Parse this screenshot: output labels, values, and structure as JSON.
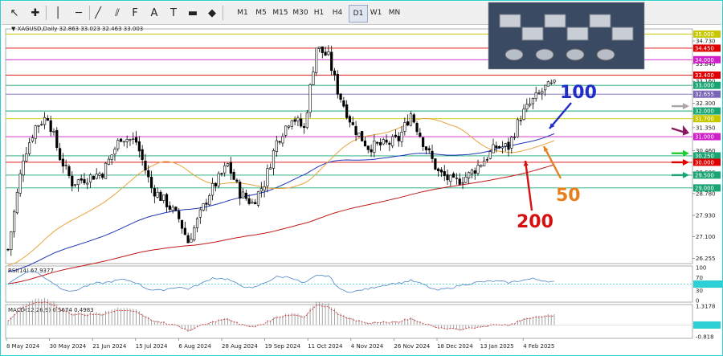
{
  "toolbar": {
    "tools": [
      {
        "icon": "cursor-arrow-icon"
      },
      {
        "icon": "crosshair-icon"
      },
      {
        "icon": "vertical-line-icon"
      },
      {
        "icon": "horizontal-line-icon"
      },
      {
        "icon": "trend-line-icon"
      },
      {
        "icon": "channel-icon"
      },
      {
        "icon": "fibonacci-icon"
      },
      {
        "icon": "text-icon"
      },
      {
        "icon": "text-label-icon"
      },
      {
        "icon": "rectangle-icon"
      },
      {
        "icon": "shapes-icon"
      }
    ],
    "timeframes": [
      "M1",
      "M5",
      "M15",
      "M30",
      "H1",
      "H4",
      "D1",
      "W1",
      "MN"
    ],
    "active_timeframe": "D1"
  },
  "colors": {
    "background": "#ffffff",
    "candle": "#000000",
    "ma50": "#e8a33d",
    "ma100": "#1f36b8",
    "ma200": "#c01818",
    "rsi": "#4a86c8",
    "macd": "#9a9a9a",
    "macd_signal": "#cc2a2a",
    "magenta_level": "#d01fc8",
    "green_level": "#1aa673",
    "red_level": "#e00000",
    "label_gray": "#aaa6a6",
    "label_blue": "#1f2ec8",
    "label_orange": "#e87f1e",
    "label_red": "#d60f0f"
  },
  "chart_data": {
    "type": "candlestick",
    "symbol": "XAGUSD,Daily",
    "ohlc": "32.863 33.023 32.463 33.003",
    "price_axis_ticks": [
      "34.730",
      "33.840",
      "33.160",
      "32.300",
      "31.350",
      "30.460",
      "29.600",
      "28.780",
      "27.930",
      "27.100",
      "26.255"
    ],
    "time_axis_labels": [
      "8 May 2024",
      "30 May 2024",
      "21 Jun 2024",
      "15 Jul 2024",
      "6 Aug 2024",
      "28 Aug 2024",
      "19 Sep 2024",
      "11 Oct 2024",
      "4 Nov 2024",
      "26 Nov 2024",
      "18 Dec 2024",
      "13 Jan 2025",
      "4 Feb 2025"
    ],
    "ylim": [
      26.05,
      35.2
    ],
    "levels": [
      {
        "value": 35.0,
        "label": "35.000",
        "color": "#c8c800"
      },
      {
        "value": 34.45,
        "label": "34.450",
        "color": "#e00000"
      },
      {
        "value": 34.0,
        "label": "34.000",
        "color": "#d01fc8"
      },
      {
        "value": 33.4,
        "label": "33.400",
        "color": "#e00000"
      },
      {
        "value": 33.0,
        "label": "33.000",
        "color": "#1aa673"
      },
      {
        "value": 32.655,
        "label": "32.655",
        "color": "#7a66b8"
      },
      {
        "value": 32.0,
        "label": "32.000",
        "color": "#1aa673"
      },
      {
        "value": 31.7,
        "label": "31.700",
        "color": "#c8c800"
      },
      {
        "value": 31.0,
        "label": "31.000",
        "color": "#d01fc8"
      },
      {
        "value": 30.25,
        "label": "30.250",
        "color": "#1aa673"
      },
      {
        "value": 30.0,
        "label": "30.000",
        "color": "#e00000"
      },
      {
        "value": 29.5,
        "label": "29.500",
        "color": "#1aa673"
      },
      {
        "value": 29.0,
        "label": "29.000",
        "color": "#1aa673"
      }
    ],
    "annotations": [
      {
        "text": "100",
        "target": "MA 100"
      },
      {
        "text": "50",
        "target": "MA 50"
      },
      {
        "text": "200",
        "target": "MA 200"
      }
    ],
    "rsi": {
      "label": "RSI(14) 67.9377",
      "ticks": [
        "100",
        "70",
        "50.0000",
        "30",
        "0"
      ],
      "level_label": "50.0000",
      "ylim": [
        0,
        100
      ]
    },
    "macd": {
      "label": "MACD(12,26,9) 0.5674 0.4983",
      "ticks": [
        "1.3178",
        "0.0000",
        "-0.818"
      ],
      "zero_label": "0.0000",
      "ylim": [
        -0.818,
        1.3178
      ]
    }
  }
}
